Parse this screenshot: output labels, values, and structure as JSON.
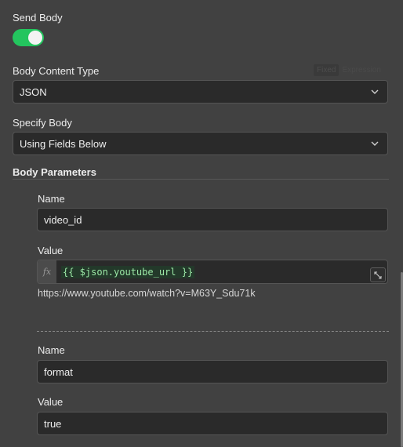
{
  "send_body": {
    "label": "Send Body",
    "enabled": true
  },
  "body_content_type": {
    "label": "Body Content Type",
    "mode_toggle": {
      "fixed": "Fixed",
      "expression": "Expression"
    },
    "value": "JSON"
  },
  "specify_body": {
    "label": "Specify Body",
    "value": "Using Fields Below"
  },
  "body_parameters": {
    "label": "Body Parameters",
    "items": [
      {
        "name_label": "Name",
        "name_value": "video_id",
        "value_label": "Value",
        "value_expression": "{{ $json.youtube_url }}",
        "value_result": "https://www.youtube.com/watch?v=M63Y_Sdu71k"
      },
      {
        "name_label": "Name",
        "name_value": "format",
        "value_label": "Value",
        "value_value": "true"
      }
    ]
  },
  "icons": {
    "expression": "fx",
    "toggle_on_color": "#23c55e",
    "chevron": "chevron-down-icon",
    "expand": "expand-icon"
  }
}
